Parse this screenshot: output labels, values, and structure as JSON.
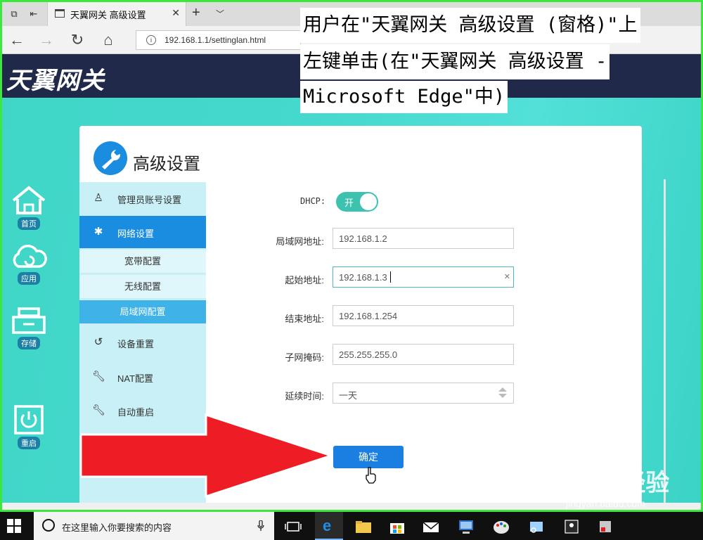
{
  "browser": {
    "tab_title": "天翼网关 高级设置",
    "url": "192.168.1.1/settinglan.html"
  },
  "page": {
    "logo": "天翼网关",
    "left_nav": [
      {
        "label": "首页",
        "icon": "home-icon"
      },
      {
        "label": "应用",
        "icon": "cloud-icon"
      },
      {
        "label": "存储",
        "icon": "storage-icon"
      },
      {
        "label": "重启",
        "icon": "power-icon"
      }
    ],
    "card_title": "高级设置",
    "menu": {
      "admin": "管理员账号设置",
      "network": "网络设置",
      "sub": [
        "宽带配置",
        "无线配置",
        "局域网配置"
      ],
      "reset": "设备重置",
      "nat": "NAT配置",
      "auto_restart": "自动重启"
    },
    "form": {
      "dhcp_label": "DHCP:",
      "dhcp_toggle": "开",
      "lan_label": "局域网地址:",
      "lan_value": "192.168.1.2",
      "start_label": "起始地址:",
      "start_value": "192.168.1.3",
      "end_label": "结束地址:",
      "end_value": "192.168.1.254",
      "mask_label": "子网掩码:",
      "mask_value": "255.255.255.0",
      "lease_label": "延续时间:",
      "lease_value": "一天",
      "confirm": "确定"
    }
  },
  "tooltip": {
    "lines": [
      "用户在\"天翼网关 高级设置 (窗格)\"上",
      "左键单击(在\"天翼网关 高级设置 -",
      "Microsoft Edge\"中)"
    ]
  },
  "watermark": {
    "logo": "Bai du 经验",
    "url": "jingyan.baidu.com"
  },
  "taskbar": {
    "search_placeholder": "在这里输入你要搜索的内容"
  },
  "colors": {
    "accent": "#1a8de0",
    "teal_bg": "#45d8cd",
    "banner": "#20294a",
    "highlight_border": "#3be83b",
    "arrow": "#ee1c24"
  }
}
